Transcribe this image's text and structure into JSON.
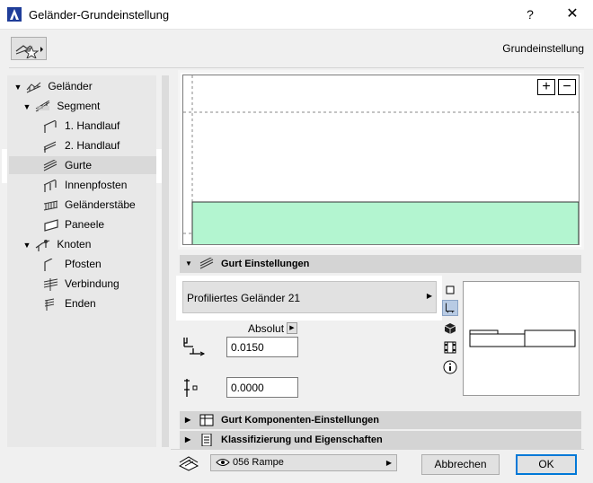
{
  "window": {
    "title": "Geländer-Grundeinstellung",
    "help": "?",
    "close": "✕"
  },
  "header": {
    "right_label": "Grundeinstellung"
  },
  "tree": [
    {
      "label": "Geländer",
      "level": 0,
      "expanded": true
    },
    {
      "label": "Segment",
      "level": 1,
      "expanded": true
    },
    {
      "label": "1. Handlauf",
      "level": 2
    },
    {
      "label": "2. Handlauf",
      "level": 2
    },
    {
      "label": "Gurte",
      "level": 2,
      "selected": true
    },
    {
      "label": "Innenpfosten",
      "level": 2
    },
    {
      "label": "Geländerstäbe",
      "level": 2
    },
    {
      "label": "Paneele",
      "level": 2
    },
    {
      "label": "Knoten",
      "level": 1,
      "expanded": true
    },
    {
      "label": "Pfosten",
      "level": 2
    },
    {
      "label": "Verbindung",
      "level": 2
    },
    {
      "label": "Enden",
      "level": 2
    }
  ],
  "preview": {
    "zoom_in": "+",
    "zoom_out": "−",
    "fill_color": "#b3f5d0"
  },
  "sections": {
    "gurt": "Gurt Einstellungen",
    "komponenten": "Gurt Komponenten-Einstellungen",
    "klassifizierung": "Klassifizierung und Eigenschaften"
  },
  "profile": {
    "value": "Profiliertes Geländer 21"
  },
  "absolut_label": "Absolut",
  "inputs": {
    "offset": "0.0150",
    "height": "0.0000"
  },
  "footer": {
    "layer": "056 Rampe",
    "cancel": "Abbrechen",
    "ok": "OK"
  }
}
